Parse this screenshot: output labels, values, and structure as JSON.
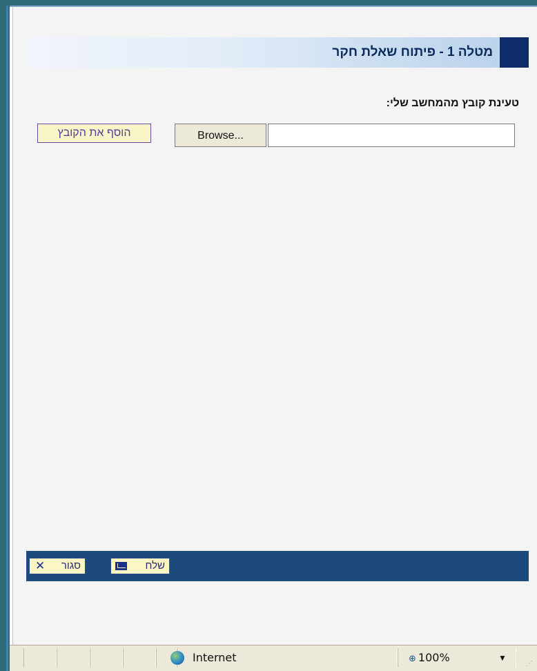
{
  "header": {
    "title": "מטלה 1 - פיתוח שאלת חקר"
  },
  "upload": {
    "label": "טעינת קובץ מהמחשב שלי:",
    "file_value": "",
    "browse_label": "Browse...",
    "add_file_label": "הוסף את הקובץ"
  },
  "footer": {
    "close_label": "סגור",
    "close_icon": "close-icon",
    "send_label": "שלח",
    "send_icon": "envelope-icon"
  },
  "status": {
    "zone_label": "Internet",
    "zoom_label": "100%"
  },
  "colors": {
    "header_dark": "#0f2d6b",
    "bottom_bar": "#1c4a7c",
    "button_bg": "#fbf6c4"
  }
}
